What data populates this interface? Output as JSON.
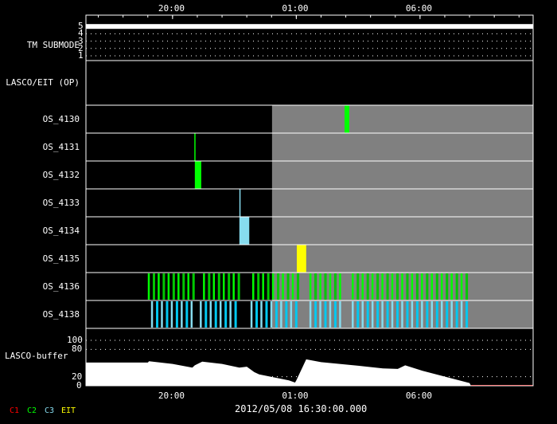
{
  "chart_data": {
    "type": "timeline",
    "title": "2012/05/08 16:30:00.000",
    "x_unit": "hours since 2012/05/08 16:30",
    "xlim": [
      0,
      18.07
    ],
    "x_ticks": [
      {
        "label": "20:00",
        "h": 3.5
      },
      {
        "label": "01:00",
        "h": 8.5
      },
      {
        "label": "06:00",
        "h": 13.5
      }
    ],
    "gray_region_start": 7.52,
    "tm_submode": {
      "label": "TM SUBMODE",
      "ticks": [
        "5",
        "4",
        "3",
        "2",
        "1"
      ],
      "value": 5
    },
    "op_row": {
      "label": "LASCO/EIT (OP)"
    },
    "rows": [
      {
        "label": "OS_4130",
        "events": [
          [
            10.45,
            10.64,
            "#00ff00"
          ]
        ]
      },
      {
        "label": "OS_4131",
        "events": [
          [
            4.38,
            4.42,
            "#00ff00"
          ]
        ]
      },
      {
        "label": "OS_4132",
        "events": [
          [
            4.4,
            4.66,
            "#00ff00"
          ]
        ]
      },
      {
        "label": "OS_4133",
        "events": [
          [
            6.2,
            6.24,
            "#87dcef"
          ]
        ]
      },
      {
        "label": "OS_4134",
        "events": [
          [
            6.2,
            6.6,
            "#87dcef"
          ]
        ]
      },
      {
        "label": "OS_4135",
        "events": [
          [
            8.52,
            8.9,
            "#ffff00"
          ]
        ]
      },
      {
        "label": "OS_4136",
        "groups": [
          [
            2.5,
            4.34
          ],
          [
            4.73,
            6.24
          ],
          [
            6.72,
            8.52
          ],
          [
            9.03,
            10.42
          ],
          [
            10.74,
            15.47
          ]
        ],
        "colors": [
          "#00ff00",
          "#00c800"
        ]
      },
      {
        "label": "OS_4138",
        "groups": [
          [
            2.63,
            4.3
          ],
          [
            4.6,
            6.1
          ],
          [
            6.65,
            8.5
          ],
          [
            9.03,
            10.42
          ],
          [
            10.74,
            15.53
          ]
        ],
        "colors": [
          "#87dcef",
          "#00c8f0"
        ]
      }
    ],
    "buffer": {
      "label": "LASCO-buffer",
      "ylim": [
        0,
        100
      ],
      "y_ticks": [
        "100",
        "80",
        "20",
        "0"
      ],
      "points": [
        [
          0,
          51
        ],
        [
          2.5,
          51
        ],
        [
          2.55,
          54
        ],
        [
          3.5,
          48
        ],
        [
          4.3,
          40
        ],
        [
          4.4,
          45
        ],
        [
          4.7,
          53
        ],
        [
          5.5,
          48
        ],
        [
          6.2,
          40
        ],
        [
          6.5,
          42
        ],
        [
          6.8,
          30
        ],
        [
          7.0,
          25
        ],
        [
          8.2,
          12
        ],
        [
          8.45,
          7
        ],
        [
          8.5,
          12
        ],
        [
          8.9,
          58
        ],
        [
          9.5,
          52
        ],
        [
          11,
          44
        ],
        [
          12,
          38
        ],
        [
          12.6,
          37
        ],
        [
          12.9,
          45
        ],
        [
          13.6,
          33
        ],
        [
          15.5,
          6
        ],
        [
          15.56,
          0
        ],
        [
          18.07,
          0
        ]
      ]
    }
  },
  "legend": [
    {
      "label": "C1",
      "color": "#ff0000"
    },
    {
      "label": "C2",
      "color": "#00ff00"
    },
    {
      "label": "C3",
      "color": "#87dcef"
    },
    {
      "label": "EIT",
      "color": "#ffff00"
    }
  ]
}
